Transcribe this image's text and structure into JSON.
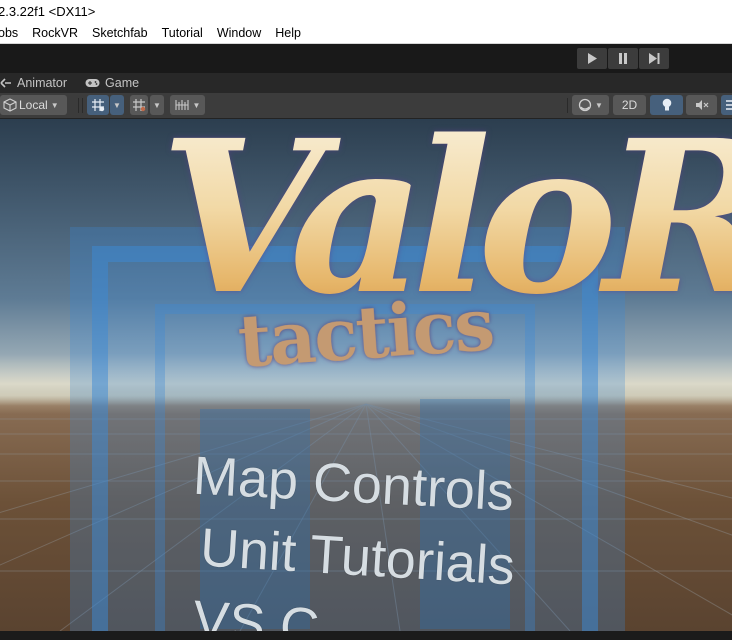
{
  "window": {
    "title": "2.3.22f1 <DX11>"
  },
  "menubar": {
    "items": [
      "obs",
      "RockVR",
      "Sketchfab",
      "Tutorial",
      "Window",
      "Help"
    ]
  },
  "playbar": {
    "buttons": [
      {
        "name": "play",
        "icon": "play-icon"
      },
      {
        "name": "pause",
        "icon": "pause-icon"
      },
      {
        "name": "step",
        "icon": "step-forward-icon"
      }
    ]
  },
  "tabs": [
    {
      "label": "Animator",
      "icon": "animator-icon"
    },
    {
      "label": "Game",
      "icon": "gamepad-icon"
    }
  ],
  "scene_toolbar": {
    "pivot_rotation_label": "Local",
    "mode_2d_label": "2D"
  },
  "scene": {
    "logo_title": "ValoR",
    "logo_subtitle": "tactics",
    "menu_items": [
      "Map Controls",
      "Unit Tutorials",
      "VS C"
    ]
  },
  "colors": {
    "toolbar_bg": "#3c3c3c",
    "active_button": "#46607c",
    "panel_frame": "#3b8ad6"
  }
}
